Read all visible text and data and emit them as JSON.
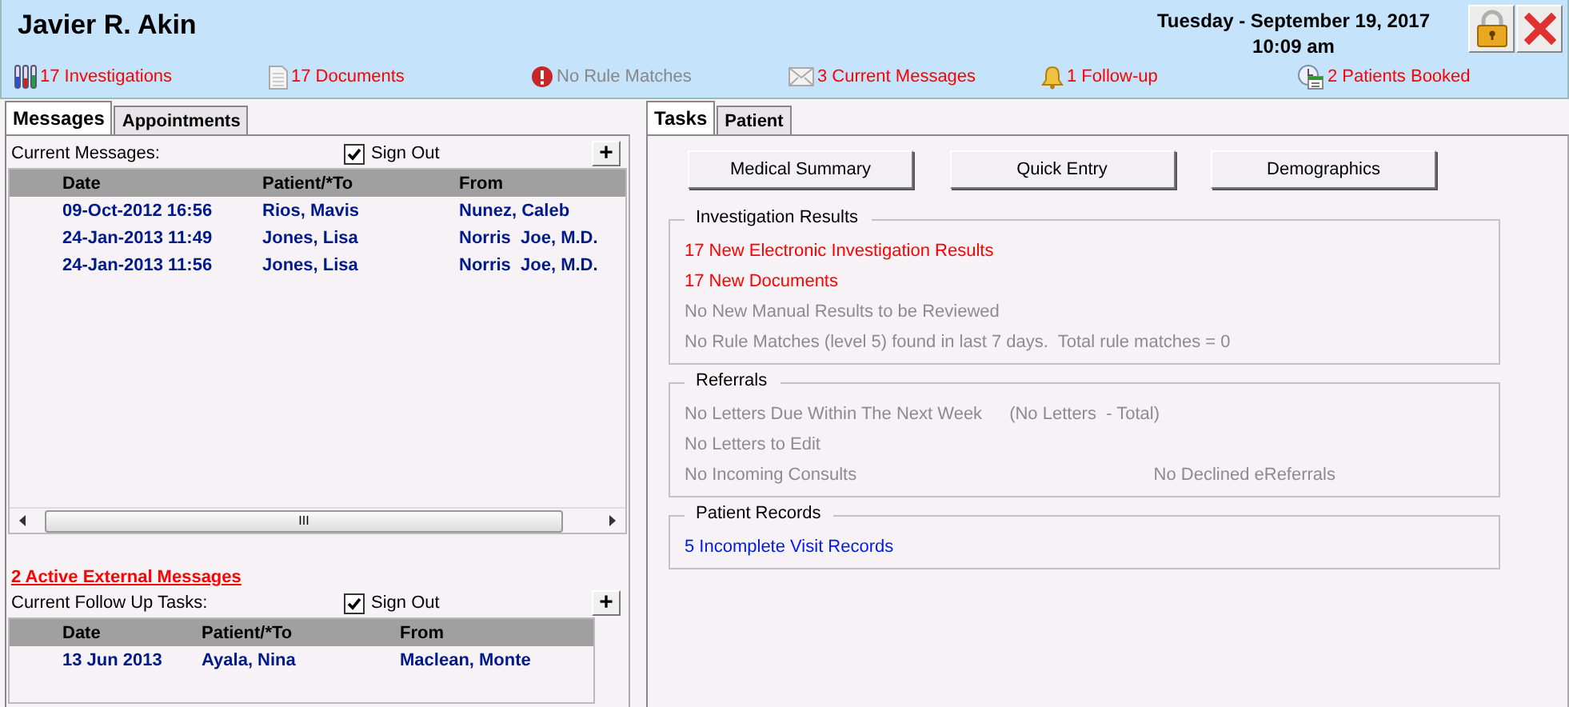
{
  "header": {
    "patient_name": "Javier R. Akin",
    "date": "Tuesday - September 19, 2017",
    "time": "10:09 am",
    "buttons": [
      {
        "kind": "lock"
      },
      {
        "kind": "close"
      }
    ]
  },
  "stats": [
    {
      "kind": "tubes",
      "text": "17 Investigations",
      "highlighted": true
    },
    {
      "kind": "document",
      "text": "17 Documents",
      "highlighted": true
    },
    {
      "kind": "warning",
      "text": "No Rule Matches",
      "highlighted": false
    },
    {
      "kind": "envelope",
      "text": "3 Current Messages",
      "highlighted": true
    },
    {
      "kind": "bell",
      "text": "1 Follow-up",
      "highlighted": true
    },
    {
      "kind": "clock",
      "text": "2 Patients Booked",
      "highlighted": true
    }
  ],
  "left_tabs": [
    {
      "label": "Messages",
      "selected": true
    },
    {
      "label": "Appointments",
      "selected": false
    }
  ],
  "messages": {
    "label": "Current Messages:",
    "sign_out": {
      "label": "Sign Out",
      "checked": true
    },
    "add": "+",
    "columns": [
      "Date",
      "Patient/*To",
      "From"
    ],
    "rows": [
      [
        "09-Oct-2012 16:56",
        "Rios, Mavis",
        "Nunez, Caleb"
      ],
      [
        "24-Jan-2013 11:49",
        "Jones, Lisa",
        "Norris  Joe, M.D."
      ],
      [
        "24-Jan-2013 11:56",
        "Jones, Lisa",
        "Norris  Joe, M.D."
      ]
    ],
    "scroll_grip": "III"
  },
  "external_link": "2 Active External Messages",
  "follow_ups": {
    "label": "Current Follow Up Tasks:",
    "sign_out": {
      "label": "Sign Out",
      "checked": true
    },
    "add": "+",
    "columns": [
      "Date",
      "Patient/*To",
      "From"
    ],
    "rows": [
      [
        "13 Jun 2013",
        "Ayala, Nina",
        "Maclean, Monte"
      ]
    ]
  },
  "right_tabs": [
    {
      "label": "Tasks",
      "selected": true
    },
    {
      "label": "Patient",
      "selected": false
    }
  ],
  "actions": [
    "Medical Summary",
    "Quick Entry",
    "Demographics"
  ],
  "groups": [
    {
      "title": "Investigation Results",
      "lines": [
        {
          "color": "#ff0000",
          "text": "17 New Electronic Investigation Results"
        },
        {
          "color": "#ff0000",
          "text": "17 New Documents"
        },
        {
          "color": "#8c8c8c",
          "text": "No New Manual Results to be Reviewed"
        },
        {
          "color": "#8c8c8c",
          "text": "No Rule Matches (level 5) found in last 7 days.  Total rule matches = 0"
        }
      ]
    },
    {
      "title": "Referrals",
      "lines": [
        {
          "color": "#8c8c8c",
          "text": "No Letters Due Within The Next Week",
          "extra": {
            "kind": "note",
            "text": "(No Letters  - Total)"
          }
        },
        {
          "color": "#8c8c8c",
          "text": "No Letters to Edit"
        },
        {
          "color": "#8c8c8c",
          "text": "No Incoming Consults",
          "extra": {
            "kind": "column",
            "text": "No Declined eReferrals"
          }
        }
      ]
    },
    {
      "title": "Patient Records",
      "lines": [
        {
          "color": "#0018f0",
          "text": "5 Incomplete Visit Records"
        }
      ]
    }
  ]
}
